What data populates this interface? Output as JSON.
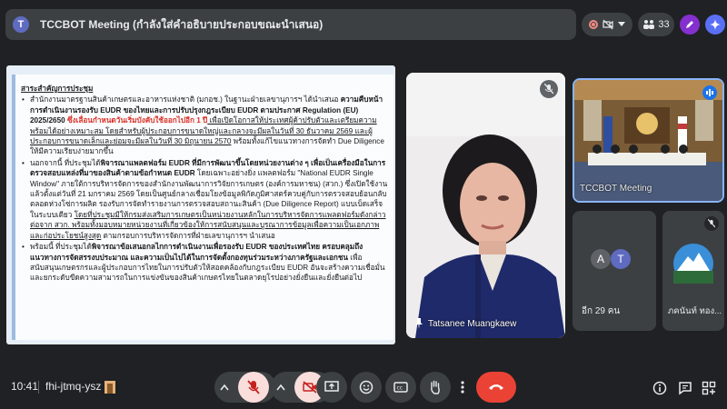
{
  "header": {
    "avatar_letter": "T",
    "title": "TCCBOT Meeting (กำลังใส่คำอธิบายประกอบขณะนำเสนอ)",
    "participant_count": "33"
  },
  "slide": {
    "heading": "สาระสำคัญการประชุม",
    "p1": [
      {
        "t": "สำนักงานมาตรฐานสินค้าเกษตรและอาหารแห่งชาติ (มกอช.) ในฐานะฝ่ายเลขานุการฯ ได้นำเสนอ ",
        "s": ""
      },
      {
        "t": "ความคืบหน้าการดำเนินงานรองรับ EUDR ของไทยและการปรับปรุงกฎระเบียบ EUDR ตามประกาศ Regulation (EU) 2025/2650 ",
        "s": "b"
      },
      {
        "t": "ซึ่งเลื่อนกำหนดวันเริ่มบังคับใช้ออกไปอีก 1 ปี",
        "s": "red"
      },
      {
        "t": " เพื่อเปิดโอกาสให้ประเทศผู้ค้าปรับตัวและเตรียมความพร้อมได้อย่างเหมาะสม โดยสำหรับผู้ประกอบการขนาดใหญ่และกลางจะมีผลในวันที่ 30 ธันวาคม 2569 และผู้ประกอบการขนาดเล็กและย่อมจะมีผลในวันที่ 30 มิถุนายน 2570",
        "s": "u"
      },
      {
        "t": " พร้อมทั้งแก้ไขแนวทางการจัดทำ Due Diligence ให้มีความเรียบง่ายมากขึ้น",
        "s": ""
      }
    ],
    "p2": [
      {
        "t": "นอกจากนี้ ที่ประชุมได้",
        "s": ""
      },
      {
        "t": "พิจารณาแพลตฟอร์ม EUDR ที่มีการพัฒนาขึ้นโดยหน่วยงานต่าง ๆ เพื่อเป็นเครื่องมือในการตรวจสอบแหล่งที่มาของสินค้าตามข้อกำหนด EUDR",
        "s": "b"
      },
      {
        "t": " โดยเฉพาะอย่างยิ่ง แพลตฟอร์ม \"National EUDR Single Window\" ภายใต้การบริหารจัดการของสำนักงานพัฒนาการวิจัยการเกษตร (องค์การมหาชน) (สวก.) ซึ่งเปิดใช้งานแล้วตั้งแต่วันที่ 21 มกราคม 2569 โดยเป็นศูนย์กลางเชื่อมโยงข้อมูลพิกัดภูมิศาสตร์ควบคู่กับการตรวจสอบย้อนกลับตลอดห่วงโซ่การผลิต รองรับการจัดทำรายงานการตรวจสอบสถานะสินค้า (Due Diligence Report) แบบเบ็ดเสร็จในระบบเดียว ",
        "s": ""
      },
      {
        "t": "โดยที่ประชุมมีให้กรมส่งเสริมการเกษตรเป็นหน่วยงานหลักในการบริหารจัดการแพลตฟอร์มดังกล่าวต่อจาก สวก. พร้อมทั้งมอบหมายหน่วยงานที่เกี่ยวข้องให้การสนับสนุนและบูรณาการข้อมูลเพื่อความเป็นเอกภาพและก่อประโยชน์สูงสุด",
        "s": "u"
      },
      {
        "t": " ตามกรอบการบริหารจัดการที่ฝ่ายเลขานุการฯ นำเสนอ",
        "s": ""
      }
    ],
    "p3": [
      {
        "t": "พร้อมนี้ ที่ประชุมได้",
        "s": ""
      },
      {
        "t": "พิจารณาข้อเสนอกลไกการดำเนินงานเพื่อรองรับ EUDR ของประเทศไทย ครอบคลุมถึงแนวทางการจัดสรรงบประมาณ และความเป็นไปได้ในการจัดตั้งกองทุนร่วมระหว่างภาครัฐและเอกชน",
        "s": "b"
      },
      {
        "t": " เพื่อสนับสนุนเกษตรกรและผู้ประกอบการไทยในการปรับตัวให้สอดคล้องกับกฎระเบียบ EUDR อันจะสร้างความเชื่อมั่น และยกระดับขีดความสามารถในการแข่งขันของสินค้าเกษตรไทยในตลาดยุโรปอย่างยั่งยืนและยั่งยืนต่อไป",
        "s": ""
      }
    ]
  },
  "tiles": {
    "main_name": "Tatsanee Muangkaew",
    "room_name": "TCCBOT Meeting",
    "others_label": "อีก 29 คน",
    "other_a": "A",
    "other_t": "T",
    "profile_name": "ภคนันท์ ทอง..."
  },
  "bottom": {
    "time": "10:41",
    "meeting_code": "fhi-jtmq-ysz"
  },
  "colors": {
    "accent": "#8ab4f8",
    "end_call": "#ea4335",
    "avatar_t": "#5f6bc0"
  }
}
